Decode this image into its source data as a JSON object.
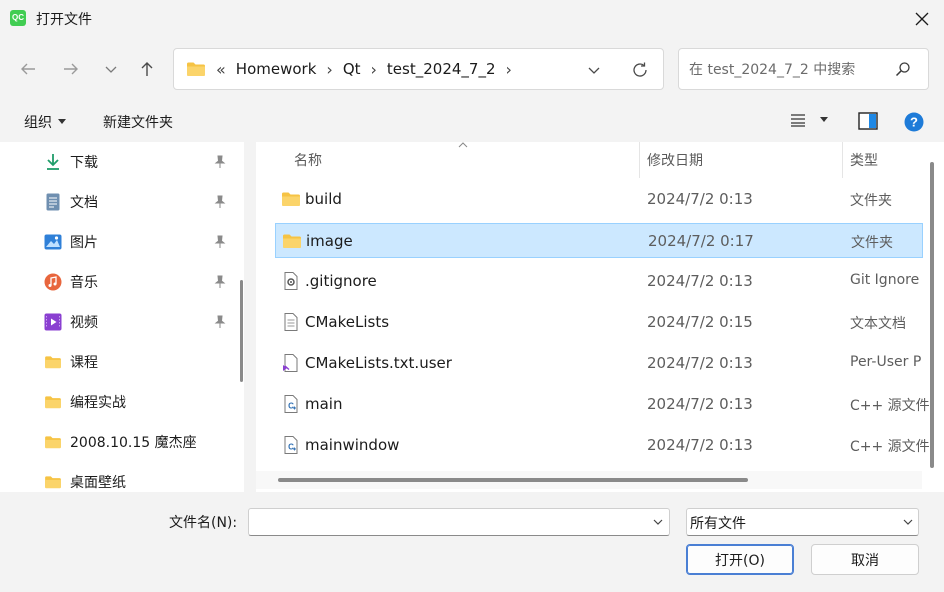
{
  "window": {
    "title": "打开文件",
    "app_icon_text": "QC"
  },
  "nav": {
    "breadcrumb_prefix": "«",
    "crumbs": [
      "Homework",
      "Qt",
      "test_2024_7_2"
    ],
    "search_placeholder": "在 test_2024_7_2 中搜索"
  },
  "commands": {
    "organize": "组织",
    "new_folder": "新建文件夹"
  },
  "sidebar": {
    "items": [
      {
        "label": "下载",
        "icon": "download-icon",
        "pinned": true
      },
      {
        "label": "文档",
        "icon": "document-icon",
        "pinned": true
      },
      {
        "label": "图片",
        "icon": "pictures-icon",
        "pinned": true
      },
      {
        "label": "音乐",
        "icon": "music-icon",
        "pinned": true
      },
      {
        "label": "视频",
        "icon": "video-icon",
        "pinned": true
      },
      {
        "label": "课程",
        "icon": "folder-icon",
        "pinned": false
      },
      {
        "label": "编程实战",
        "icon": "folder-icon",
        "pinned": false
      },
      {
        "label": "2008.10.15 魔杰座",
        "icon": "folder-icon",
        "pinned": false
      },
      {
        "label": "桌面壁纸",
        "icon": "folder-icon",
        "pinned": false
      }
    ]
  },
  "files": {
    "columns": {
      "name": "名称",
      "date": "修改日期",
      "type": "类型"
    },
    "rows": [
      {
        "name": "build",
        "date": "2024/7/2 0:13",
        "type": "文件夹",
        "icon": "folder-icon",
        "selected": false
      },
      {
        "name": "image",
        "date": "2024/7/2 0:17",
        "type": "文件夹",
        "icon": "folder-icon",
        "selected": true
      },
      {
        "name": ".gitignore",
        "date": "2024/7/2 0:13",
        "type": "Git Ignore",
        "icon": "gear-file-icon",
        "selected": false
      },
      {
        "name": "CMakeLists",
        "date": "2024/7/2 0:15",
        "type": "文本文档",
        "icon": "text-file-icon",
        "selected": false
      },
      {
        "name": "CMakeLists.txt.user",
        "date": "2024/7/2 0:13",
        "type": "Per-User P",
        "icon": "vs-file-icon",
        "selected": false
      },
      {
        "name": "main",
        "date": "2024/7/2 0:13",
        "type": "C++ 源文件",
        "icon": "cpp-file-icon",
        "selected": false
      },
      {
        "name": "mainwindow",
        "date": "2024/7/2 0:13",
        "type": "C++ 源文件",
        "icon": "cpp-file-icon",
        "selected": false
      }
    ]
  },
  "footer": {
    "filename_label": "文件名(N):",
    "filename_value": "",
    "filter_value": "所有文件",
    "open_label": "打开(O)",
    "cancel_label": "取消"
  },
  "colors": {
    "accent": "#0067c0",
    "selection": "#cce8ff",
    "folder": "#f6c344"
  }
}
